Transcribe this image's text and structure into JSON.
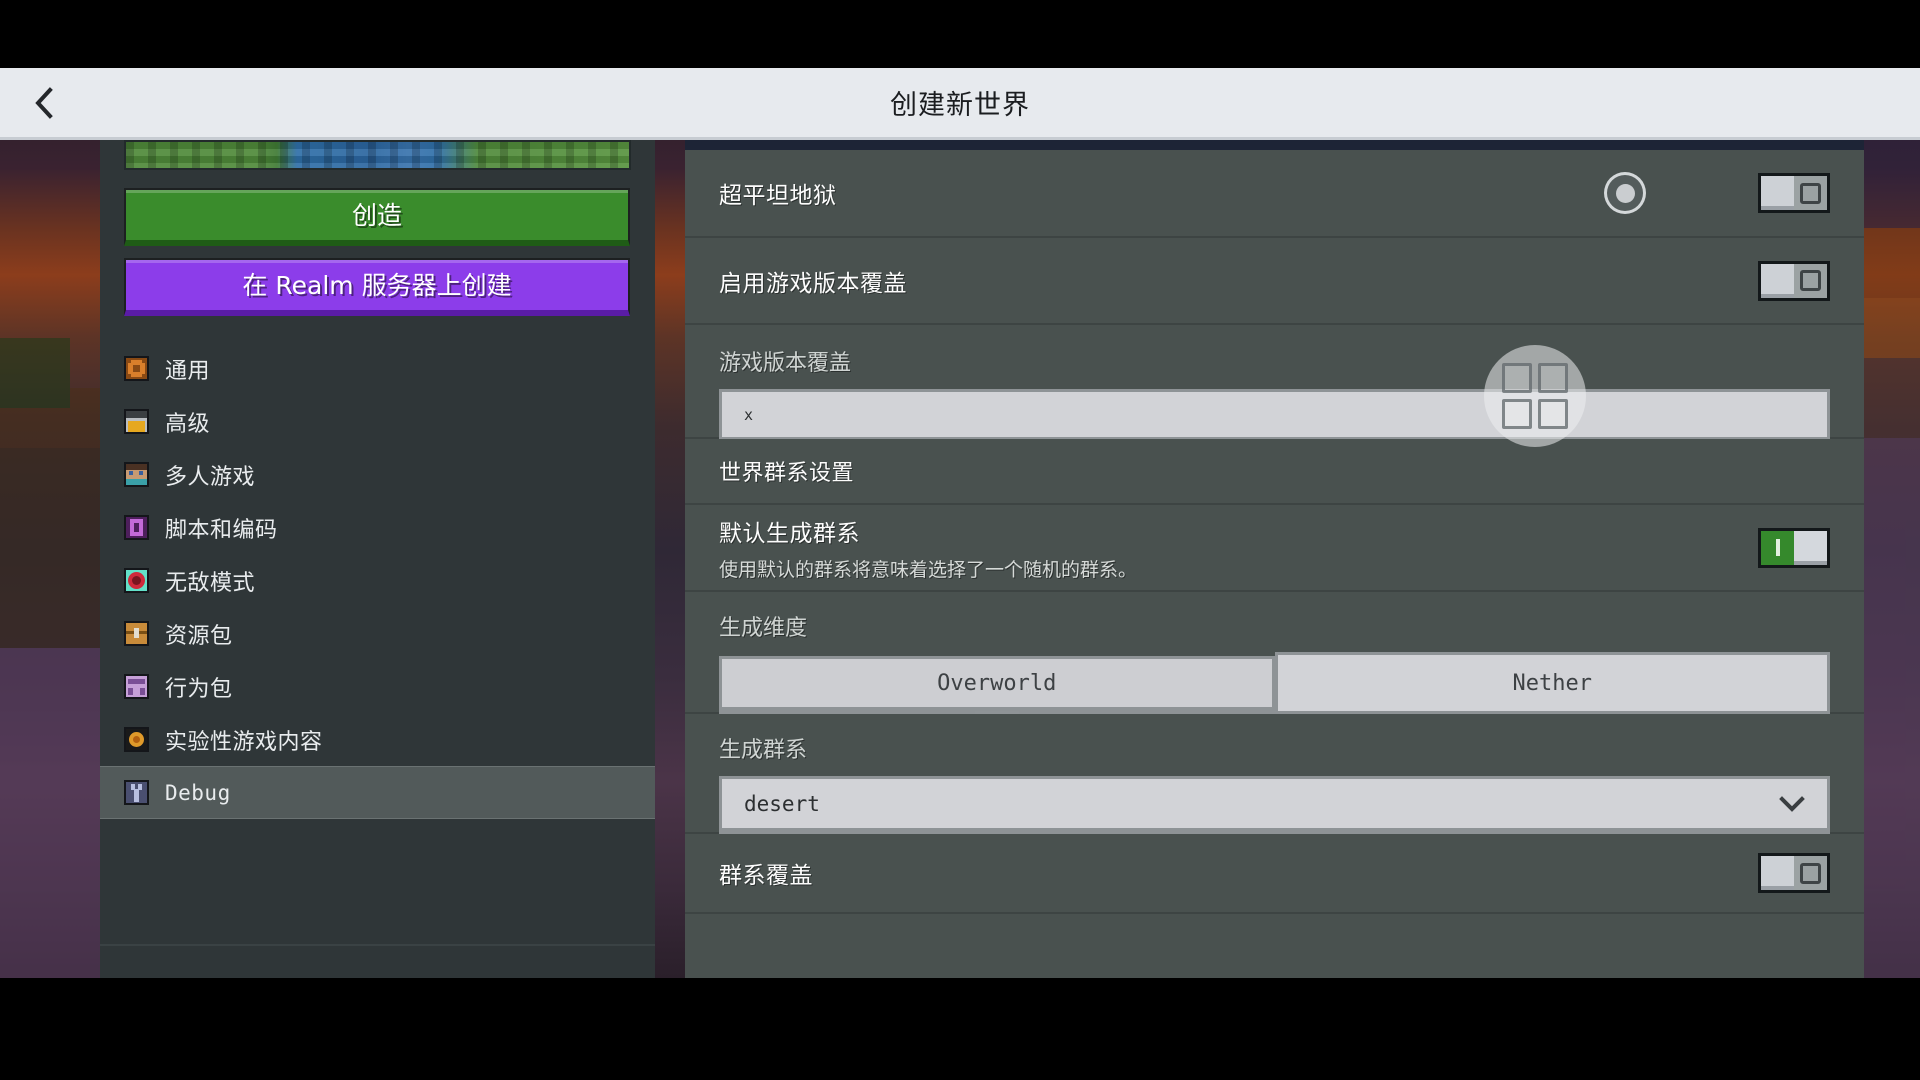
{
  "header": {
    "title": "创建新世界",
    "back_icon": "chevron-left-icon"
  },
  "sidebar": {
    "create_button": "创造",
    "realm_button": "在 Realm 服务器上创建",
    "items": [
      {
        "label": "通用",
        "icon": "gear-icon",
        "active": false,
        "color": "#d97f2b",
        "color2": "#8a4a14"
      },
      {
        "label": "高级",
        "icon": "furnace-icon",
        "active": false,
        "color": "#c9cccf",
        "color2": "#e6a81f"
      },
      {
        "label": "多人游戏",
        "icon": "steve-head-icon",
        "active": false,
        "color": "#c89a72",
        "color2": "#3aa0a8"
      },
      {
        "label": "脚本和编码",
        "icon": "puzzle-icon",
        "active": false,
        "color": "#c36ad8",
        "color2": "#4d1f5c"
      },
      {
        "label": "无敌模式",
        "icon": "shield-icon",
        "active": false,
        "color": "#cf2a3c",
        "color2": "#63e0c8"
      },
      {
        "label": "资源包",
        "icon": "chest-icon",
        "active": false,
        "color": "#c88b3a",
        "color2": "#d8d2c4"
      },
      {
        "label": "行为包",
        "icon": "behavior-icon",
        "active": false,
        "color": "#c6a0d8",
        "color2": "#7a4f96"
      },
      {
        "label": "实验性游戏内容",
        "icon": "flask-icon",
        "active": false,
        "color": "#e09a2a",
        "color2": "#1a1a1a"
      },
      {
        "label": "Debug",
        "icon": "wrench-icon",
        "active": true,
        "color": "#b8bfe0",
        "color2": "#4a4f70"
      }
    ]
  },
  "settings": {
    "rows": [
      {
        "name": "flat-nether",
        "title": "超平坦地狱",
        "sub": "",
        "control": "toggle",
        "value": "off"
      },
      {
        "name": "enable-version-override",
        "title": "启用游戏版本覆盖",
        "sub": "",
        "control": "toggle",
        "value": "off"
      }
    ],
    "version_override": {
      "label": "游戏版本覆盖",
      "value": "x",
      "placeholder": ""
    },
    "biome_section_title": "世界群系设置",
    "default_spawn_biome": {
      "title": "默认生成群系",
      "sub": "使用默认的群系将意味着选择了一个随机的群系。",
      "value": "on"
    },
    "spawn_dimension": {
      "label": "生成维度",
      "options": [
        "Overworld",
        "Nether"
      ],
      "selected": "Overworld"
    },
    "spawn_biome": {
      "label": "生成群系",
      "value": "desert",
      "chevron": "chevron-down-icon"
    },
    "biome_override": {
      "title": "群系覆盖",
      "control": "toggle",
      "value": "off"
    }
  },
  "overlays": {
    "touch_indicator": "touch-pointer-icon",
    "floating_menu": "grid-menu-icon"
  },
  "colors": {
    "panel": "#49514f",
    "sidebar": "#2f3638",
    "accent_green": "#3a8c2c",
    "accent_purple": "#8c3dea",
    "titlebar": "#e7eaee"
  }
}
